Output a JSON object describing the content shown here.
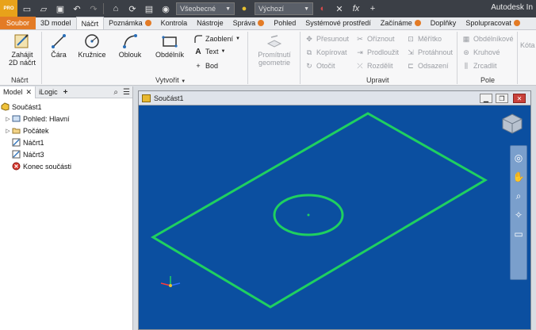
{
  "app": {
    "title": "Autodesk In",
    "logo": "PRO"
  },
  "qat": {
    "material_select": "Všeobecné",
    "appearance_select": "Výchozí"
  },
  "tabs": [
    {
      "label": "Soubor"
    },
    {
      "label": "3D model"
    },
    {
      "label": "Náčrt"
    },
    {
      "label": "Poznámka"
    },
    {
      "label": "Kontrola"
    },
    {
      "label": "Nástroje"
    },
    {
      "label": "Správa"
    },
    {
      "label": "Pohled"
    },
    {
      "label": "Systémové prostředí"
    },
    {
      "label": "Začínáme"
    },
    {
      "label": "Doplňky"
    },
    {
      "label": "Spolupracovat"
    }
  ],
  "ribbon": {
    "start_sketch": "Zahájit 2D náčrt",
    "line": "Čára",
    "circle": "Kružnice",
    "arc": "Oblouk",
    "rectangle": "Obdélník",
    "fillet": "Zaoblení",
    "text": "Text",
    "point": "Bod",
    "project_geometry": "Promítnutí geometrie",
    "move": "Přesunout",
    "copy": "Kopírovat",
    "rotate": "Otočit",
    "trim": "Oříznout",
    "extend": "Prodloužit",
    "split": "Rozdělit",
    "scale": "Měřítko",
    "stretch": "Protáhnout",
    "offset": "Odsazení",
    "rect_pattern": "Obdélníkové",
    "circ_pattern": "Kruhové",
    "mirror": "Zrcadlit",
    "dimension": "Kóta",
    "panels": {
      "sketch": "Náčrt",
      "create": "Vytvořit",
      "modify": "Upravit",
      "pattern": "Pole"
    }
  },
  "browser": {
    "tab_model": "Model",
    "tab_ilogic": "iLogic",
    "items": [
      {
        "label": "Součást1"
      },
      {
        "label": "Pohled: Hlavní"
      },
      {
        "label": "Počátek"
      },
      {
        "label": "Náčrt1"
      },
      {
        "label": "Náčrt3"
      },
      {
        "label": "Konec součásti"
      }
    ]
  },
  "graphics": {
    "title": "Součást1",
    "background": "#0b4fa0",
    "sketch_color": "#1fd060"
  },
  "colors": {
    "accent": "#e37b25",
    "ribbon_bg": "#f7f7f8",
    "titlebar": "#3b3f46"
  }
}
